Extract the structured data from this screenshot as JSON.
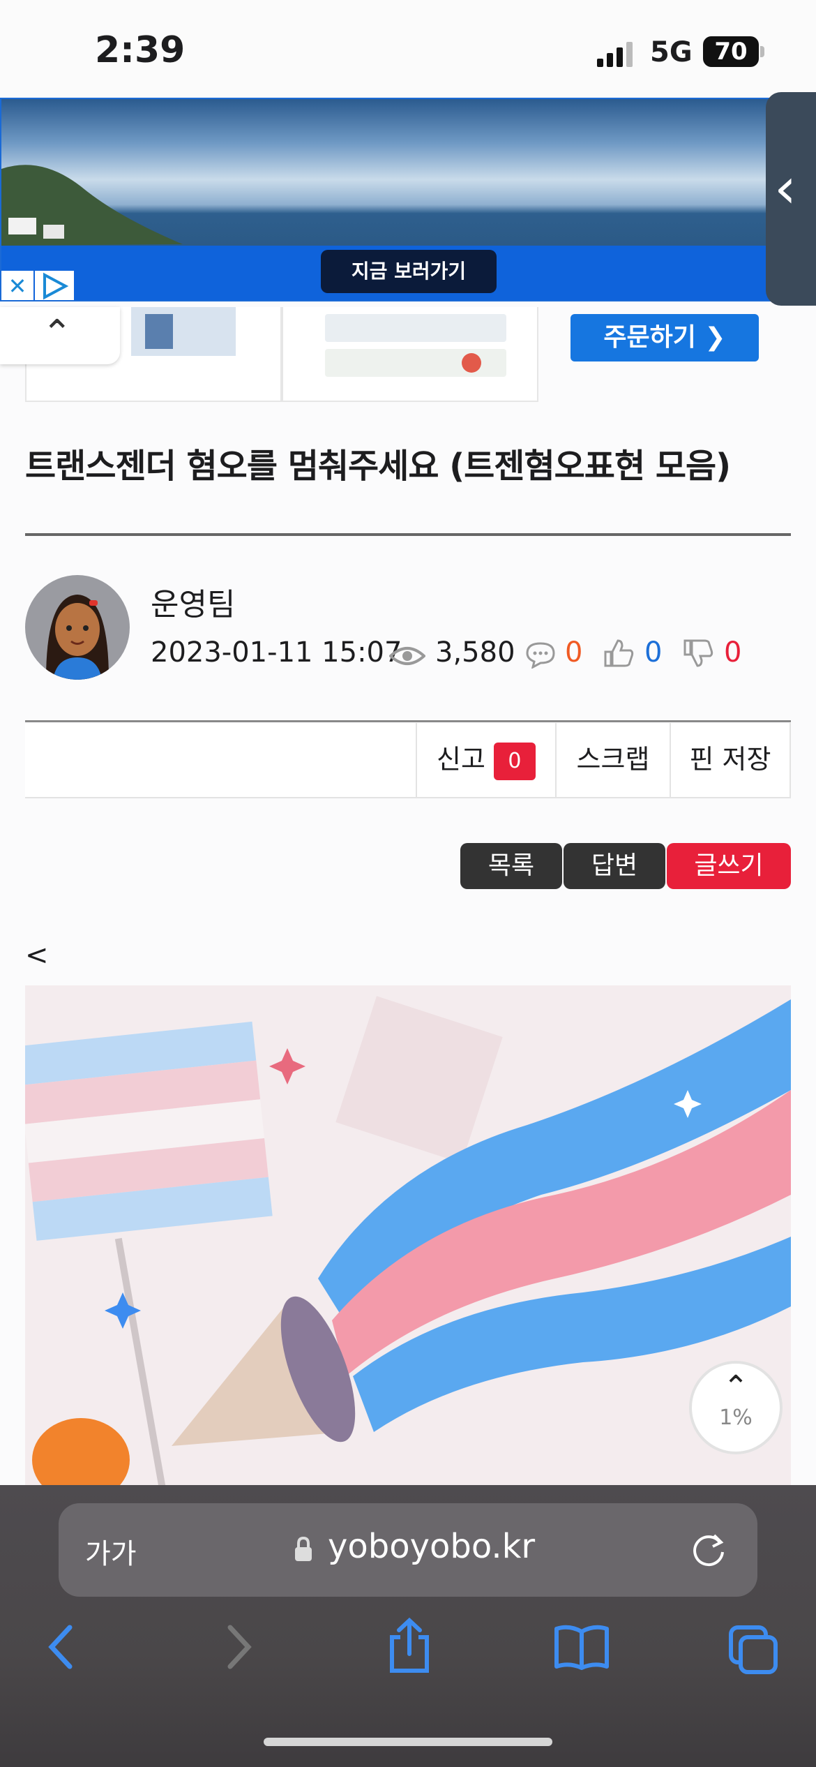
{
  "status_bar": {
    "time": "2:39",
    "network": "5G",
    "battery": "70"
  },
  "ad": {
    "cta": "지금 보러가기",
    "close_glyph": "✕"
  },
  "product_strip": {
    "order_label": "주문하기 ❯"
  },
  "post": {
    "title": "트랜스젠더 혐오를 멈춰주세요 (트젠혐오표현 모음)",
    "author": "운영팀",
    "datetime": "2023-01-11 15:07",
    "views": "3,580",
    "comments": "0",
    "likes": "0",
    "dislikes": "0"
  },
  "actions": {
    "report_label": "신고",
    "report_count": "0",
    "scrap_label": "스크랩",
    "pin_label": "핀 저장"
  },
  "nav_buttons": {
    "list": "목록",
    "reply": "답변",
    "write": "글쓰기"
  },
  "content": {
    "lead": "<"
  },
  "scroll_top": {
    "percent": "1%"
  },
  "safari": {
    "aa": "가가",
    "url": "yoboyobo.kr"
  },
  "colors": {
    "accent_blue": "#1676e0",
    "accent_red": "#e8203a",
    "dark_button": "#333333",
    "comment_orange": "#f05a23",
    "like_blue": "#1c6fd8",
    "dislike_red": "#e8203a"
  },
  "icons": [
    "signal-icon",
    "battery-icon",
    "ad-close-icon",
    "ad-play-icon",
    "chevron-left-icon",
    "chevron-up-icon",
    "eye-icon",
    "comment-icon",
    "thumbs-up-icon",
    "thumbs-down-icon",
    "lock-icon",
    "reload-icon",
    "back-icon",
    "forward-icon",
    "share-icon",
    "bookmarks-icon",
    "tabs-icon"
  ]
}
